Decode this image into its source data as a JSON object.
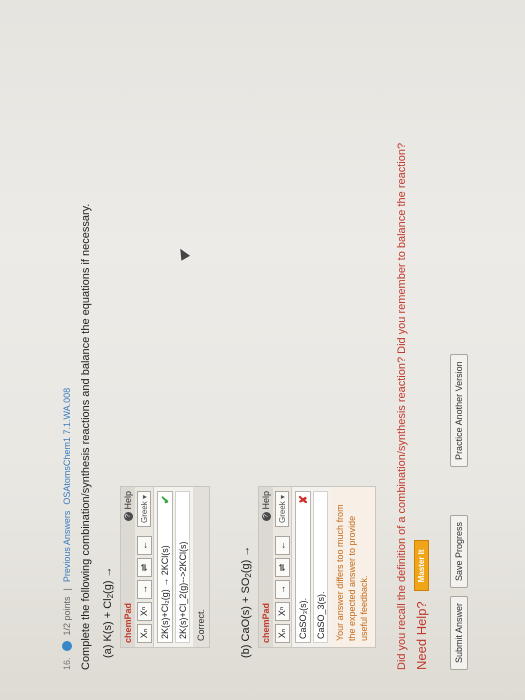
{
  "header": {
    "question_number": "16.",
    "points": "1/2 points",
    "separator": "|",
    "prev_answers": "Previous Answers",
    "course_code": "OSAtomsChem1 7.1.WA.008"
  },
  "instructions": "Complete the following combination/synthesis reactions and balance the equations if necessary.",
  "part_a": {
    "label_prefix": "(a)",
    "reaction_main": "K(s) + Cl",
    "reaction_sub": "2",
    "reaction_tail": "(g) →",
    "chempad": {
      "name": "chemPad",
      "help": "Help",
      "greek": "Greek ▾",
      "tools": [
        "Xₙ",
        "Xⁿ",
        "→",
        "⇌",
        "←"
      ],
      "entry": "2K(s)+Cl₂(g) → 2KCl(s)",
      "preview": "2K(s)+Cl_2(g)-->2KCl(s)",
      "status": "Correct."
    }
  },
  "part_b": {
    "label_prefix": "(b)",
    "reaction_main": "CaO(s) + SO",
    "reaction_sub": "2",
    "reaction_tail": "(g) →",
    "chempad": {
      "name": "chemPad",
      "help": "Help",
      "greek": "Greek ▾",
      "tools": [
        "Xₙ",
        "Xⁿ",
        "→",
        "⇌",
        "←"
      ],
      "entry": "CaSO₃(s).",
      "preview": "CaSO_3(s).",
      "feedback_lines": [
        "Your answer differs too much from",
        "the expected answer to provide",
        "useful feedback."
      ]
    }
  },
  "hint_question": "Did you recall the definition of a combination/synthesis reaction? Did you remember to balance the reaction?",
  "need_help": {
    "label": "Need Help?",
    "button": "Master It"
  },
  "buttons": {
    "submit": "Submit Answer",
    "save": "Save Progress",
    "practice": "Practice Another Version"
  },
  "colors": {
    "accent_red": "#c0392b",
    "correct_green": "#3aa53a",
    "master_orange": "#f0a418"
  }
}
